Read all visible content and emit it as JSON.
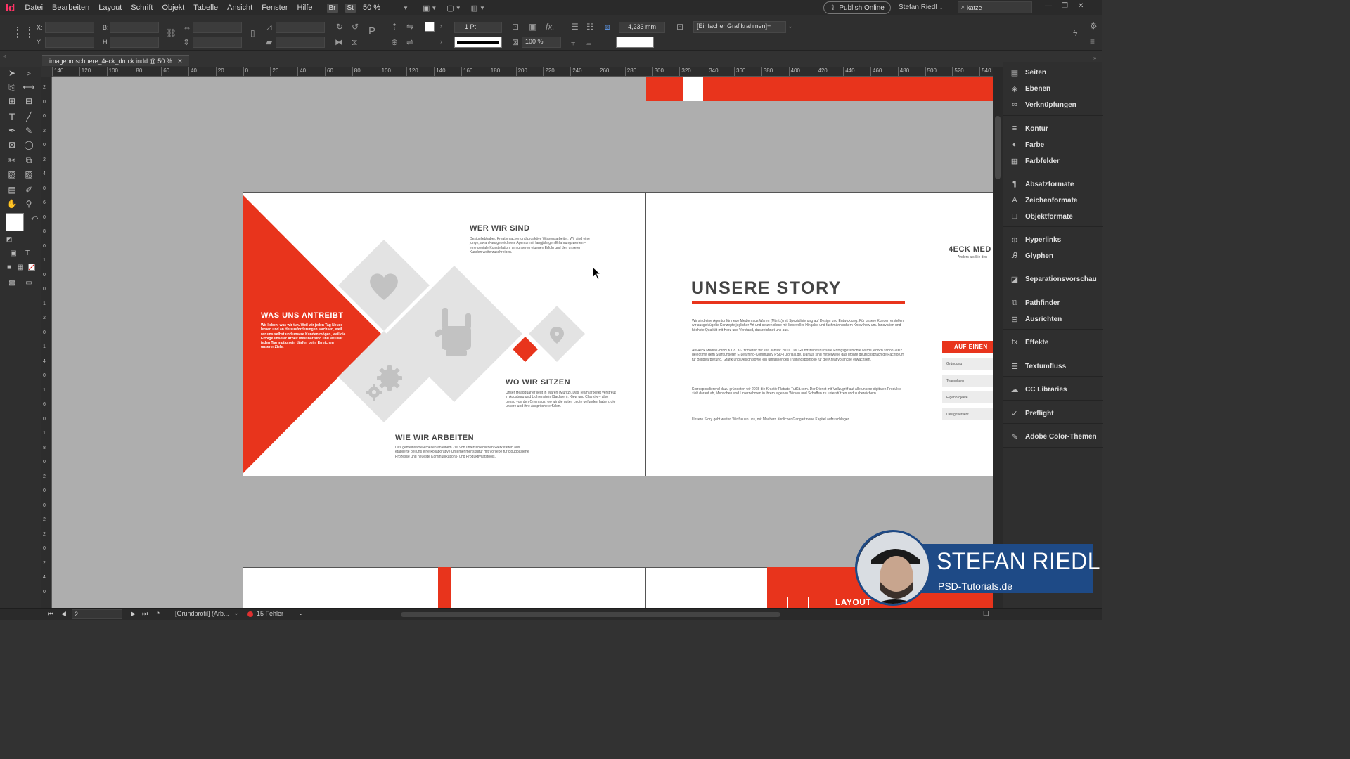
{
  "app": {
    "logo": "Id",
    "menu": [
      "Datei",
      "Bearbeiten",
      "Layout",
      "Schrift",
      "Objekt",
      "Tabelle",
      "Ansicht",
      "Fenster",
      "Hilfe"
    ],
    "bridge_badge": "Br",
    "stock_badge": "St",
    "zoom": "50 %",
    "publish_label": "Publish Online",
    "user_name": "Stefan Riedl",
    "search_value": "katze"
  },
  "control_bar": {
    "x_label": "X:",
    "y_label": "Y:",
    "w_label": "B:",
    "h_label": "H:",
    "stroke_weight": "1 Pt",
    "opacity": "100 %",
    "offset_value": "4,233 mm",
    "object_style": "[Einfacher Grafikrahmen]+"
  },
  "document_tab": {
    "title": "imagebroschuere_4eck_druck.indd @ 50 %",
    "close": "×"
  },
  "ruler": {
    "h_labels": [
      "140",
      "120",
      "100",
      "80",
      "60",
      "40",
      "20",
      "0",
      "20",
      "40",
      "60",
      "80",
      "100",
      "120",
      "140",
      "160",
      "180",
      "200",
      "220",
      "240",
      "260",
      "280",
      "300",
      "320",
      "340",
      "360",
      "380",
      "400",
      "420",
      "440",
      "460",
      "480",
      "500",
      "520",
      "540"
    ],
    "v_labels": [
      "2",
      "0",
      "0",
      "2",
      "0",
      "2",
      "4",
      "0",
      "6",
      "0",
      "8",
      "0",
      "1",
      "0",
      "0",
      "1",
      "2",
      "0",
      "1",
      "4",
      "0",
      "1",
      "6",
      "0",
      "1",
      "8",
      "0",
      "2",
      "0",
      "0",
      "2",
      "2",
      "0",
      "2",
      "4",
      "0"
    ]
  },
  "colors": {
    "accent_red": "#e8341c",
    "diamond_grey": "#e3e3e3",
    "icon_grey": "#c2c2c2"
  },
  "spread": {
    "antreibt": {
      "heading": "WAS UNS ANTREIBT",
      "body": "Wir lieben, was wir tun. Weil wir jeden Tag Neues lernen und an Herausforderungen wachsen, weil wir uns selbst und unsere Kunden mögen, weil die Erfolge unserer Arbeit messbar sind und weil wir jeden Tag mutig sein dürfen beim Erreichen unserer Ziele."
    },
    "wer": {
      "heading": "WER WIR SIND",
      "body": "Designliebhaber, Kreativmacher und proaktive Wissensarbeiter. Wir sind eine junge, award-ausgezeichnete Agentur mit langjährigen Erfahrungswerten – eine geniale Konstellation, um unseren eigenen Erfolg und den unserer Kunden weiterzuschreiben."
    },
    "wo": {
      "heading": "WO WIR SITZEN",
      "body": "Unser Headquarter liegt in Waren (Müritz). Das Team arbeitet verstreut in Augsburg und Lichtenstein (Sachsen), Kiew und Charkiw – also genau von den Orten aus, wo wir die guten Leute gefunden haben, die unsere und ihre Ansprüche erfüllen."
    },
    "wie": {
      "heading": "WIE WIR ARBEITEN",
      "body": "Das gemeinsame Arbeiten an einem Ziel von unterschiedlichen Werkstätten aus etablierte bei uns eine kollaborative Unternehmenskultur mit Vorliebe für cloudbasierte Prozesse und neueste Kommunikations- und Produktivitätstools."
    },
    "story": {
      "heading": "UNSERE STORY",
      "p1": "Wir sind eine Agentur für neue Medien aus Waren (Müritz) mit Spezialisierung auf Design und Entwicklung. Für unsere Kunden erstellen wir ausgeklügelte Konzepte jeglicher Art und setzen diese mit liebevoller Hingabe und fachmännischem Know-how um. Innovation und höchste Qualität mit Herz und Verstand, das zeichnet uns aus.",
      "p2": "Als 4eck Media GmbH & Co. KG firmieren wir seit Januar 2010. Der Grundstein für unsere Erfolgsgeschichte wurde jedoch schon 2002 gelegt mit dem Start unserer E-Learning-Community PSD-Tutorials.de. Daraus sind mittlerweile das größte deutschsprachige Fachforum für Bildbearbeitung, Grafik und Design sowie ein umfassendes Trainingsportfolio für die Kreativbranche erwachsen.",
      "p3": "Korrespondierend dazu gründeten wir 2015 die Kreativ-Flatrate TutKit.com. Der Dienst mit Vollzugriff auf alle unsere digitalen Produkte zielt darauf ab, Menschen und Unternehmen in ihrem eigenen Wirken und Schaffen zu unterstützen und zu bereichern.",
      "p4": "Unsere Story geht weiter. Wir freuen uns, mit Machern ähnlicher Gangart neue Kapitel aufzuschlagen."
    },
    "side": {
      "heading": "4ECK MED",
      "sub": "Anders als Sie den",
      "red_label": "AUF EINEN",
      "list": [
        "Gründung",
        "Teamplayer",
        "Eigenprojekte",
        "Designverliebt"
      ]
    },
    "bottom_label": "LAYOUT"
  },
  "panels": [
    {
      "icon": "pages-icon",
      "glyph": "▤",
      "label": "Seiten"
    },
    {
      "icon": "layers-icon",
      "glyph": "◈",
      "label": "Ebenen"
    },
    {
      "icon": "links-icon",
      "glyph": "∞",
      "label": "Verknüpfungen"
    },
    {
      "icon": "stroke-icon",
      "glyph": "≡",
      "label": "Kontur"
    },
    {
      "icon": "color-icon",
      "glyph": "◐",
      "label": "Farbe"
    },
    {
      "icon": "swatches-icon",
      "glyph": "▦",
      "label": "Farbfelder"
    },
    {
      "icon": "paragraph-styles-icon",
      "glyph": "¶",
      "label": "Absatzformate"
    },
    {
      "icon": "character-styles-icon",
      "glyph": "A",
      "label": "Zeichenformate"
    },
    {
      "icon": "object-styles-icon",
      "glyph": "□",
      "label": "Objektformate"
    },
    {
      "icon": "hyperlinks-icon",
      "glyph": "⊕",
      "label": "Hyperlinks"
    },
    {
      "icon": "glyphs-icon",
      "glyph": "Ꭿ",
      "label": "Glyphen"
    },
    {
      "icon": "separations-icon",
      "glyph": "◪",
      "label": "Separationsvorschau"
    },
    {
      "icon": "pathfinder-icon",
      "glyph": "⧉",
      "label": "Pathfinder"
    },
    {
      "icon": "align-icon",
      "glyph": "⊟",
      "label": "Ausrichten"
    },
    {
      "icon": "effects-icon",
      "glyph": "fx",
      "label": "Effekte"
    },
    {
      "icon": "text-wrap-icon",
      "glyph": "☰",
      "label": "Textumfluss"
    },
    {
      "icon": "cc-libraries-icon",
      "glyph": "☁",
      "label": "CC Libraries"
    },
    {
      "icon": "preflight-icon",
      "glyph": "✓",
      "label": "Preflight"
    },
    {
      "icon": "color-themes-icon",
      "glyph": "✎",
      "label": "Adobe Color-Themen"
    }
  ],
  "status": {
    "page": "2",
    "profile": "[Grundprofil] (Arb...",
    "errors": "15 Fehler"
  },
  "watermark": {
    "name": "STEFAN RIEDL",
    "site": "PSD-Tutorials.de"
  }
}
